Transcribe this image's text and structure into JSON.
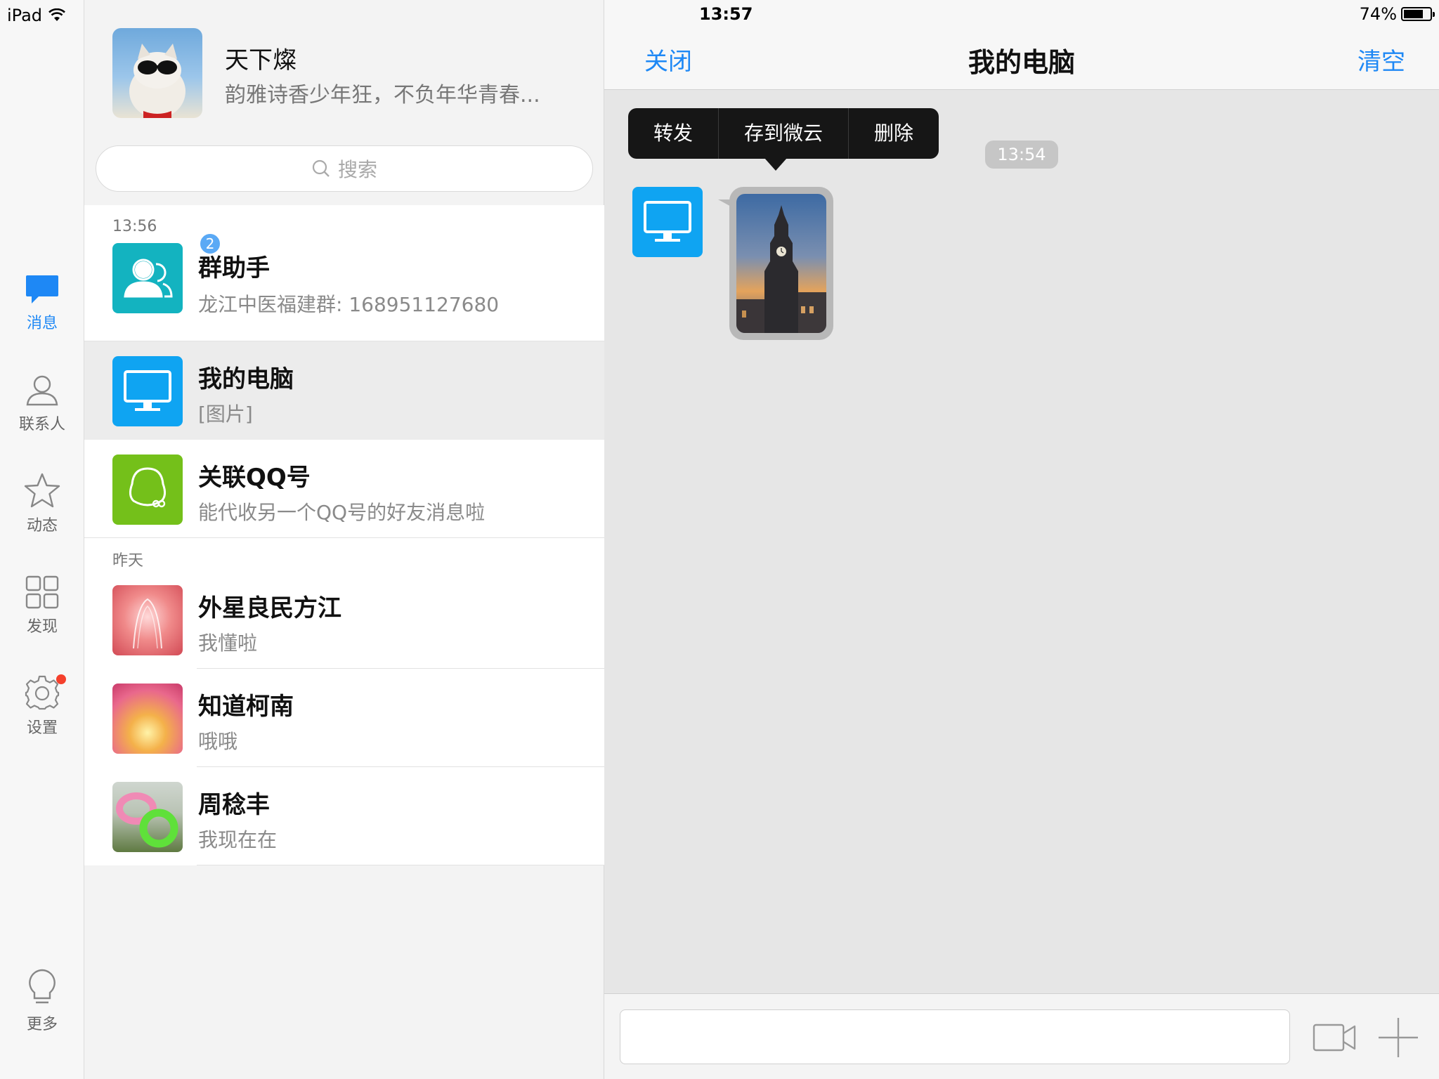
{
  "status": {
    "device": "iPad",
    "time": "13:57",
    "battery": "74%",
    "battery_level": 0.74
  },
  "rail": {
    "items": [
      {
        "label": "消息",
        "icon": "message-bubble-icon",
        "active": true
      },
      {
        "label": "联系人",
        "icon": "contact-person-icon",
        "active": false
      },
      {
        "label": "动态",
        "icon": "star-icon",
        "active": false
      },
      {
        "label": "发现",
        "icon": "grid-icon",
        "active": false
      },
      {
        "label": "设置",
        "icon": "gear-icon",
        "active": false,
        "notification_dot": true
      }
    ],
    "more": {
      "label": "更多",
      "icon": "lightbulb-icon"
    }
  },
  "profile": {
    "name": "天下燦",
    "signature": "韵雅诗香少年狂，不负年华青春..."
  },
  "search": {
    "placeholder": "搜索"
  },
  "conversations": {
    "today_label": "13:56",
    "yesterday_label": "昨天",
    "items": [
      {
        "name": "群助手",
        "preview": "龙江中医福建群: 168951127680",
        "badge": "2",
        "avatar": "group-assistant-icon"
      },
      {
        "name": "我的电脑",
        "preview": "[图片]",
        "selected": true,
        "avatar": "computer-monitor-icon"
      },
      {
        "name": "关联QQ号",
        "preview": "能代收另一个QQ号的好友消息啦",
        "avatar": "linked-qq-icon"
      },
      {
        "name": "外星良民方江",
        "preview": "我懂啦",
        "avatar": "user-avatar-pink"
      },
      {
        "name": "知道柯南",
        "preview": "哦哦",
        "avatar": "user-avatar-flower"
      },
      {
        "name": "周稔丰",
        "preview": "我现在在",
        "avatar": "user-avatar-rings"
      }
    ]
  },
  "chat": {
    "close_label": "关闭",
    "title": "我的电脑",
    "clear_label": "清空",
    "context_menu": [
      "转发",
      "存到微云",
      "删除"
    ],
    "message_time": "13:54",
    "colors": {
      "accent": "#1e88f5",
      "computer_blue": "#0fa4f2"
    }
  }
}
